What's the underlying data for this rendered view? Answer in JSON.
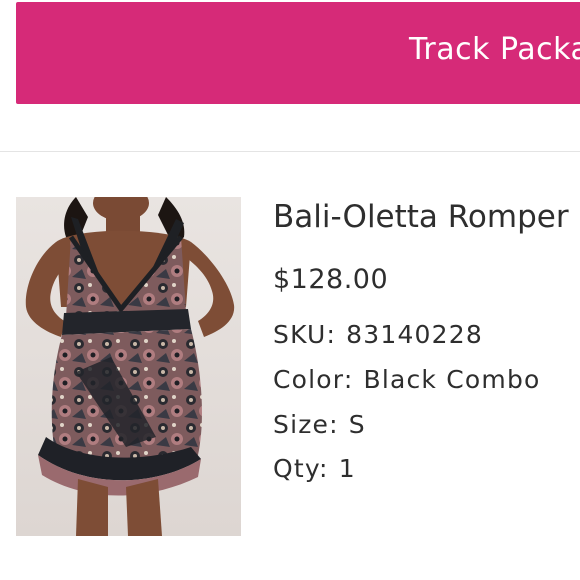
{
  "header": {
    "track_button_label": "Track Package"
  },
  "product": {
    "name": "Bali-Oletta Romper",
    "price": "$128.00",
    "image_alt": "Woman wearing a floral print romper",
    "attributes": {
      "sku_label": "SKU:",
      "sku_value": "83140228",
      "color_label": "Color:",
      "color_value": "Black Combo",
      "size_label": "Size:",
      "size_value": "S",
      "qty_label": "Qty:",
      "qty_value": "1"
    }
  },
  "colors": {
    "accent": "#d62a78",
    "text": "#2e2e2e",
    "divider": "#e4e4e4"
  }
}
